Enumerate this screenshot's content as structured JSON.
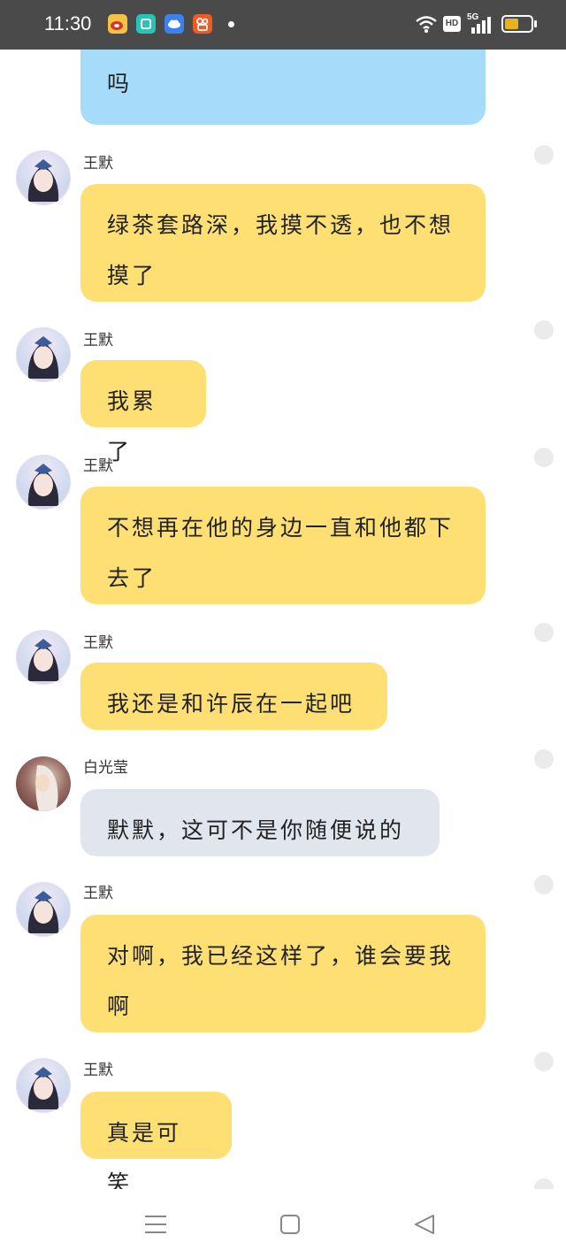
{
  "status_bar": {
    "time": "11:30",
    "apps": [
      "weibo-icon",
      "app-store-icon",
      "cloud-icon",
      "kuaishou-icon"
    ],
    "network": "5G",
    "hd": "HD",
    "battery_percent": 55
  },
  "messages": [
    {
      "sender": "",
      "text": "吗",
      "style": "blue"
    },
    {
      "sender": "王默",
      "text": "绿茶套路深，我摸不透，也不想摸了",
      "style": "yellow"
    },
    {
      "sender": "王默",
      "text": "我累了",
      "style": "yellow"
    },
    {
      "sender": "王默",
      "text": "不想再在他的身边一直和他都下去了",
      "style": "yellow"
    },
    {
      "sender": "王默",
      "text": "我还是和许辰在一起吧",
      "style": "yellow"
    },
    {
      "sender": "白光莹",
      "text": "默默，这可不是你随便说的",
      "style": "grey"
    },
    {
      "sender": "王默",
      "text": "对啊，我已经这样了，谁会要我啊",
      "style": "yellow"
    },
    {
      "sender": "王默",
      "text": "真是可笑",
      "style": "yellow"
    }
  ],
  "nav": [
    "menu-icon",
    "home-icon",
    "back-icon"
  ]
}
